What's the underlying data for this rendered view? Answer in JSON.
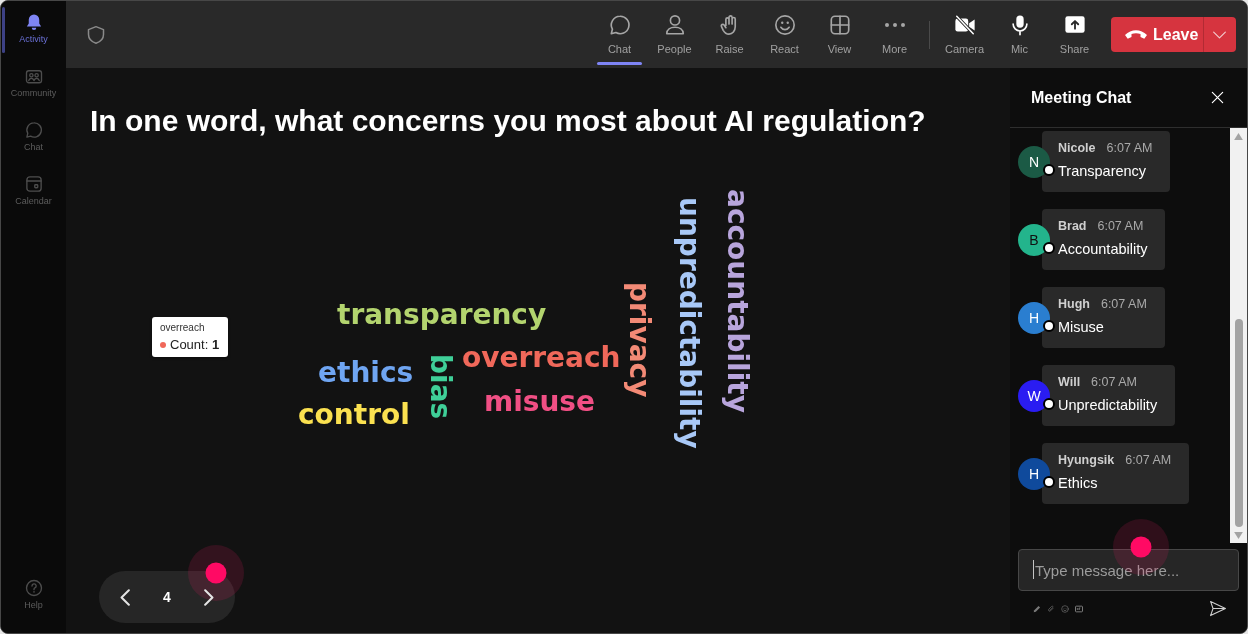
{
  "sidebar": {
    "items": [
      {
        "label": "Activity",
        "selected": true
      },
      {
        "label": "Community",
        "selected": false
      },
      {
        "label": "Chat",
        "selected": false
      },
      {
        "label": "Calendar",
        "selected": false
      }
    ],
    "help": {
      "label": "Help"
    }
  },
  "toolbar": {
    "items": [
      {
        "label": "Chat",
        "selected": true
      },
      {
        "label": "People",
        "selected": false
      },
      {
        "label": "Raise",
        "selected": false
      },
      {
        "label": "React",
        "selected": false
      },
      {
        "label": "View",
        "selected": false
      },
      {
        "label": "More",
        "selected": false
      }
    ],
    "devices": [
      {
        "label": "Camera"
      },
      {
        "label": "Mic"
      },
      {
        "label": "Share"
      }
    ],
    "leave": {
      "label": "Leave"
    }
  },
  "poll": {
    "question": "In one word, what concerns you most about AI regulation?",
    "words": [
      {
        "text": "transparency",
        "color": "#b3d46e",
        "kind": "horizontal"
      },
      {
        "text": "ethics",
        "color": "#6fa5f2",
        "kind": "horizontal"
      },
      {
        "text": "control",
        "color": "#fbe150",
        "kind": "horizontal"
      },
      {
        "text": "bias",
        "color": "#3fcf98",
        "kind": "vertical"
      },
      {
        "text": "overreach",
        "color": "#f0685a",
        "kind": "horizontal"
      },
      {
        "text": "misuse",
        "color": "#f04f84",
        "kind": "horizontal"
      },
      {
        "text": "privacy",
        "color": "#f38a76",
        "kind": "vertical"
      },
      {
        "text": "unpredictability",
        "color": "#a8c8f7",
        "kind": "vertical"
      },
      {
        "text": "accountability",
        "color": "#b8a5dc",
        "kind": "vertical"
      }
    ],
    "tooltip": {
      "word": "overreach",
      "count": "Count: **1**",
      "color": "#f0685a"
    }
  },
  "pager": {
    "page": "4"
  },
  "chat": {
    "title": "Meeting Chat",
    "messages": [
      {
        "initial": "N",
        "name": "Nicole",
        "time": "6:07 AM",
        "text": "Transparency",
        "color": "#1b5a45"
      },
      {
        "initial": "B",
        "name": "Brad",
        "time": "6:07 AM",
        "text": "Accountability",
        "color": "#23b48c"
      },
      {
        "initial": "H",
        "name": "Hugh",
        "time": "6:07 AM",
        "text": "Misuse",
        "color": "#2a7ed0"
      },
      {
        "initial": "W",
        "name": "Will",
        "time": "6:07 AM",
        "text": "Unpredictability",
        "color": "#2a1cf2"
      },
      {
        "initial": "H",
        "name": "Hyungsik",
        "time": "6:07 AM",
        "text": "Ethics",
        "color": "#0f4a9c"
      }
    ],
    "composer": {
      "placeholder": "Type message here..."
    }
  }
}
